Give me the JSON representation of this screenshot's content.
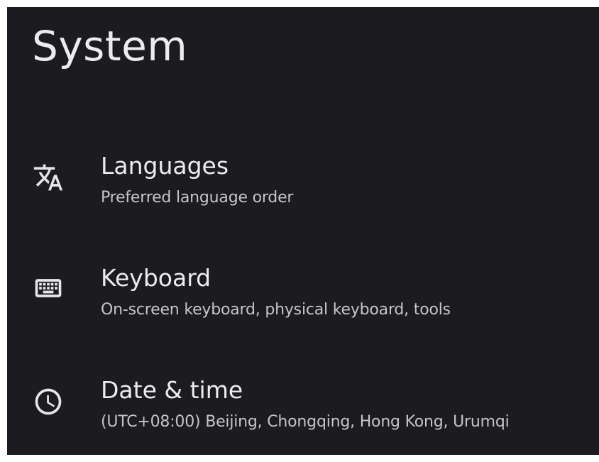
{
  "page": {
    "title": "System"
  },
  "items": [
    {
      "icon": "translate-icon",
      "title": "Languages",
      "subtitle": "Preferred language order"
    },
    {
      "icon": "keyboard-icon",
      "title": "Keyboard",
      "subtitle": "On-screen keyboard, physical keyboard, tools"
    },
    {
      "icon": "clock-icon",
      "title": "Date & time",
      "subtitle": "(UTC+08:00) Beijing, Chongqing, Hong Kong, Urumqi"
    }
  ],
  "colors": {
    "background": "#1c1c20",
    "text_primary": "#ececf0",
    "text_secondary": "#c4c4ca"
  }
}
